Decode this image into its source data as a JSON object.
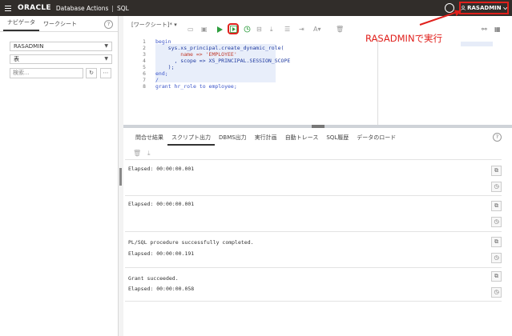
{
  "topbar": {
    "brand": "ORACLE",
    "product": "Database Actions",
    "separator": "|",
    "section": "SQL",
    "help_icon": "?",
    "user": "RASADMIN"
  },
  "left_panel": {
    "tabs": [
      "ナビゲータ",
      "ワークシート"
    ],
    "help_icon": "?",
    "schema_select": "RASADMIN",
    "type_select": "表",
    "search_placeholder": "検索...",
    "refresh_icon": "↻",
    "more_icon": "⋯"
  },
  "editor": {
    "worksheet_name": "[ワークシート]*",
    "dropdown_caret": "▾",
    "line_numbers": [
      "1",
      "2",
      "3",
      "4",
      "5",
      "6",
      "7",
      "8"
    ],
    "code": [
      "begin",
      "    sys.xs_principal.create_dynamic_role(",
      "        name => 'EMPLOYEE'",
      "      , scope => XS_PRINCIPAL.SESSION_SCOPE",
      "    );",
      "end;",
      "/",
      "grant hr_role to employee;"
    ]
  },
  "annotation": {
    "text": "RASADMINで実行"
  },
  "results": {
    "tabs": [
      "問合せ結果",
      "スクリプト出力",
      "DBMS出力",
      "実行計画",
      "自動トレース",
      "SQL履歴",
      "データのロード"
    ],
    "active_tab": "スクリプト出力",
    "help_icon": "?",
    "outputs": [
      {
        "lines": [
          "Elapsed: 00:00:00.001"
        ]
      },
      {
        "lines": [
          "Elapsed: 00:00:00.001"
        ]
      },
      {
        "lines": [
          "PL/SQL procedure successfully completed.",
          "Elapsed: 00:00:00.191"
        ]
      },
      {
        "lines": [
          "Grant succeeded.",
          "Elapsed: 00:00:00.058"
        ]
      }
    ]
  },
  "colors": {
    "topbar": "#312d2a",
    "highlight": "#e0201c",
    "keyword": "#3b55c9",
    "string": "#c0392b",
    "run_green": "#2e9e3e"
  }
}
